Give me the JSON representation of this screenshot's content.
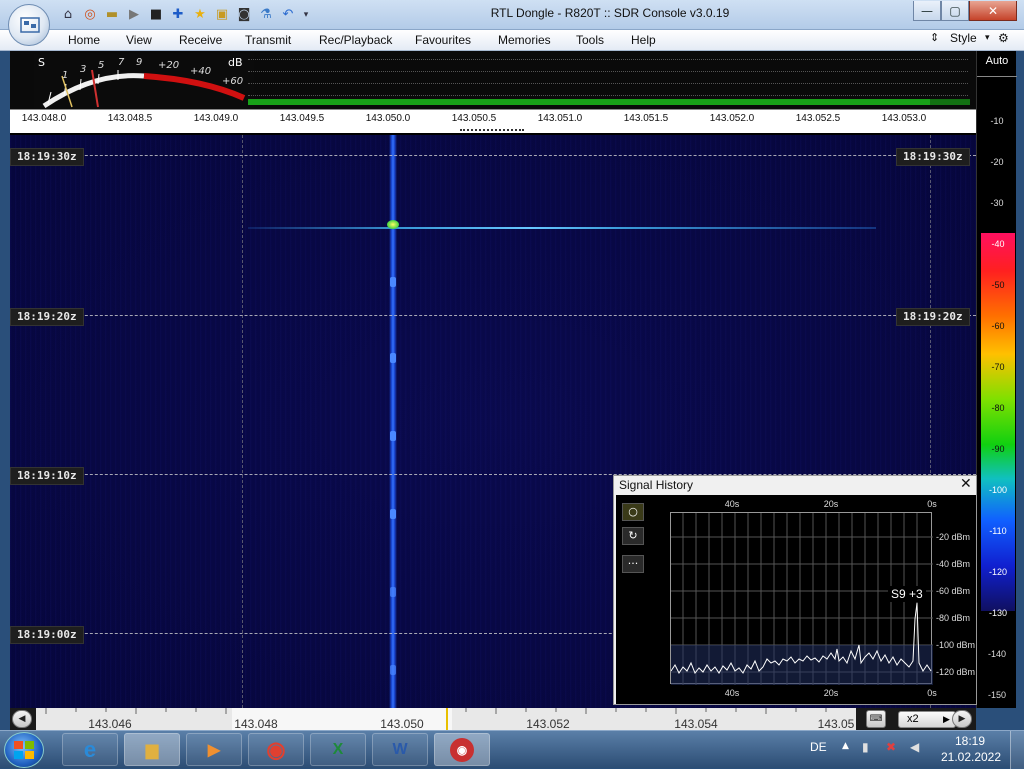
{
  "window": {
    "title": "RTL Dongle - R820T :: SDR Console v3.0.19",
    "controls": {
      "minimize": "—",
      "maximize": "▢",
      "close": "✕"
    }
  },
  "quick_access": [
    "home-icon",
    "lifebuoy-icon",
    "folder-icon",
    "play-icon",
    "stop-icon",
    "add-icon",
    "star-icon",
    "lock-icon",
    "camera-icon",
    "flask-icon",
    "undo-icon",
    "dropdown-icon"
  ],
  "menu": {
    "items": [
      "Home",
      "View",
      "Receive",
      "Transmit",
      "Rec/Playback",
      "Favourites",
      "Memories",
      "Tools",
      "Help"
    ],
    "style_label": "Style"
  },
  "smeter": {
    "s_label": "S",
    "db_label": "dB",
    "scale": [
      "1",
      "3",
      "5",
      "7",
      "9",
      "+20",
      "+40",
      "+60"
    ]
  },
  "spectrum": {
    "freq_labels": [
      "143.048.0",
      "143.048.5",
      "143.049.0",
      "143.049.5",
      "143.050.0",
      "143.050.5",
      "143.051.0",
      "143.051.5",
      "143.052.0",
      "143.052.5",
      "143.053.0"
    ]
  },
  "waterfall": {
    "time_labels": [
      "18:19:30z",
      "18:19:20z",
      "18:19:10z",
      "18:19:00z"
    ],
    "right_time_labels": [
      "18:19:30z",
      "18:19:20z"
    ]
  },
  "db_scale": {
    "auto_label": "Auto",
    "values": [
      "-10",
      "-20",
      "-30",
      "-40",
      "-50",
      "-60",
      "-70",
      "-80",
      "-90",
      "-100",
      "-110",
      "-120",
      "-130",
      "-140",
      "-150"
    ]
  },
  "bottom_bar": {
    "freq_labels": [
      "143.046",
      "143.048",
      "143.050",
      "143.052",
      "143.054",
      "143.05"
    ],
    "zoom_label": "x2"
  },
  "signal_history": {
    "title": "Signal History",
    "close": "✕",
    "x_labels_top": [
      "40s",
      "20s",
      "0s"
    ],
    "x_labels_bottom": [
      "40s",
      "20s",
      "0s"
    ],
    "y_labels": [
      "-20 dBm",
      "-40 dBm",
      "-60 dBm",
      "-80 dBm",
      "-100 dBm",
      "-120 dBm"
    ],
    "badge": "S9 +3",
    "buttons": [
      "○",
      "↻",
      "···"
    ]
  },
  "taskbar": {
    "apps": [
      "ie-icon",
      "explorer-icon",
      "media-player-icon",
      "chrome-icon",
      "excel-icon",
      "word-icon",
      "sdr-console-icon"
    ],
    "language": "DE",
    "time": "18:19",
    "date": "21.02.2022"
  }
}
